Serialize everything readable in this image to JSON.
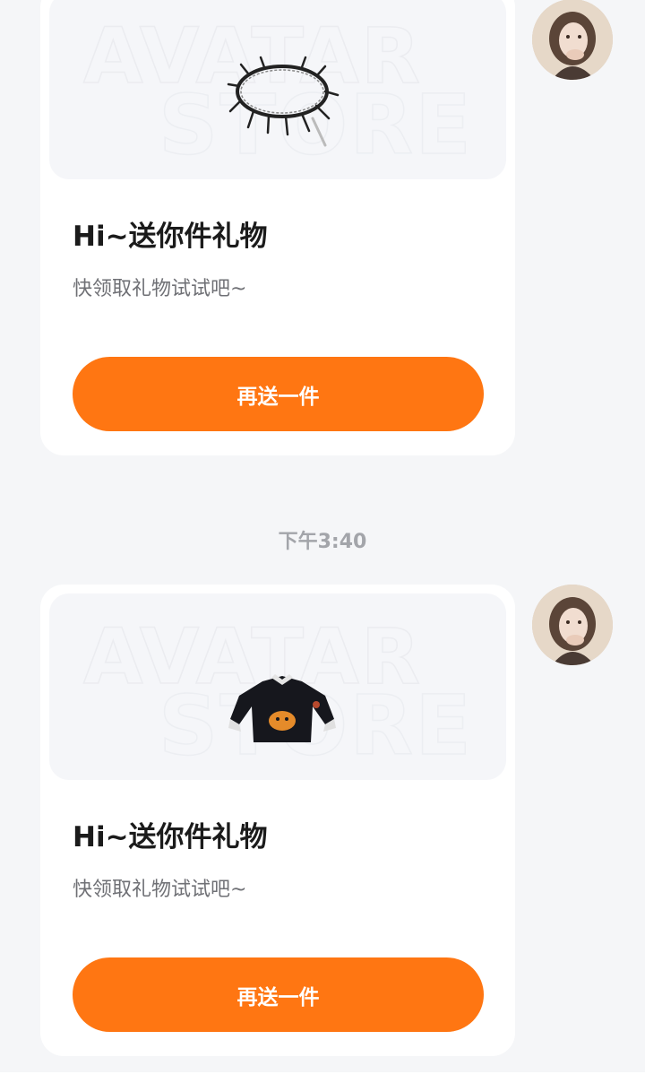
{
  "chat": {
    "messages": [
      {
        "product": "spiked-choker",
        "watermark_top": "AVATAR",
        "watermark_bottom": "STORE",
        "title": "Hi~送你件礼物",
        "subtitle": "快领取礼物试试吧~",
        "button_label": "再送一件"
      },
      {
        "product": "black-sweater",
        "watermark_top": "AVATAR",
        "watermark_bottom": "STORE",
        "title": "Hi~送你件礼物",
        "subtitle": "快领取礼物试试吧~",
        "button_label": "再送一件"
      }
    ],
    "timestamp": "下午3:40"
  },
  "colors": {
    "accent": "#ff7612",
    "background": "#f5f6f8",
    "card": "#ffffff"
  }
}
